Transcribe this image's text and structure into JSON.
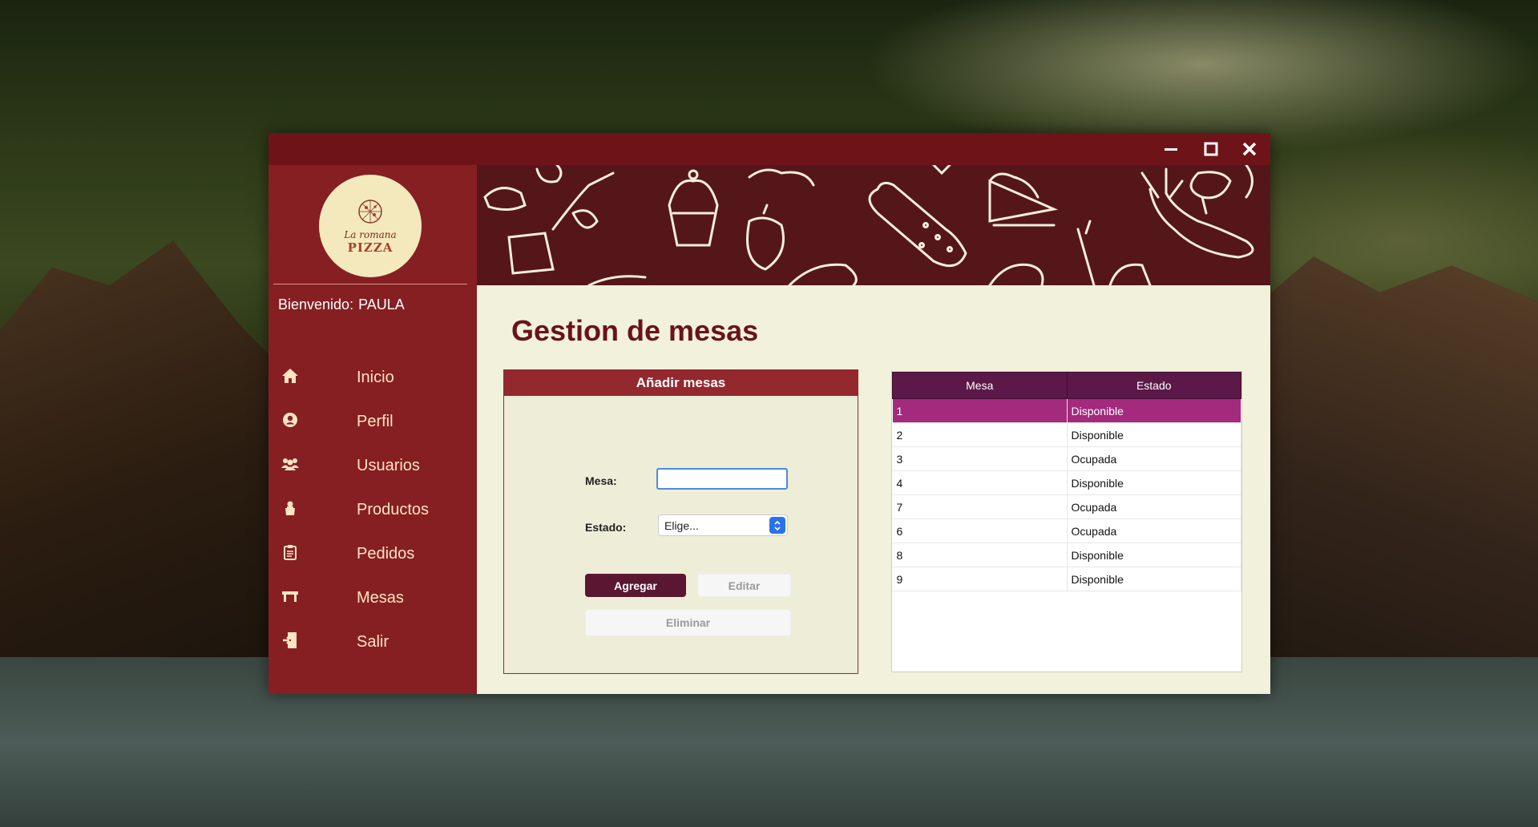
{
  "window": {
    "controls": {
      "minimize": "minimize-icon",
      "maximize": "maximize-icon",
      "close": "close-icon"
    }
  },
  "sidebar": {
    "logo": {
      "line1": "La romana",
      "line2": "PIZZA"
    },
    "welcome_label": "Bienvenido:",
    "user_name": "PAULA",
    "items": [
      {
        "label": "Inicio",
        "icon": "home-icon"
      },
      {
        "label": "Perfil",
        "icon": "user-icon"
      },
      {
        "label": "Usuarios",
        "icon": "users-icon"
      },
      {
        "label": "Productos",
        "icon": "chef-icon"
      },
      {
        "label": "Pedidos",
        "icon": "clipboard-icon"
      },
      {
        "label": "Mesas",
        "icon": "table-icon"
      },
      {
        "label": "Salir",
        "icon": "exit-icon"
      }
    ]
  },
  "main": {
    "title": "Gestion de mesas",
    "form": {
      "header": "Añadir mesas",
      "mesa_label": "Mesa:",
      "mesa_value": "",
      "estado_label": "Estado:",
      "estado_value": "Elige...",
      "agregar_label": "Agregar",
      "editar_label": "Editar",
      "eliminar_label": "Eliminar"
    },
    "table": {
      "columns": [
        "Mesa",
        "Estado"
      ],
      "rows": [
        {
          "mesa": "1",
          "estado": "Disponible",
          "selected": true
        },
        {
          "mesa": "2",
          "estado": "Disponible"
        },
        {
          "mesa": "3",
          "estado": "Ocupada"
        },
        {
          "mesa": "4",
          "estado": "Disponible"
        },
        {
          "mesa": "7",
          "estado": "Ocupada"
        },
        {
          "mesa": "6",
          "estado": "Ocupada"
        },
        {
          "mesa": "8",
          "estado": "Disponible"
        },
        {
          "mesa": "9",
          "estado": "Disponible"
        }
      ]
    }
  },
  "colors": {
    "titlebar": "#6e1419",
    "sidebar": "#861f22",
    "banner": "#55161a",
    "accent": "#5a1731",
    "table_header": "#5c1848",
    "selected_row": "#a32a7d"
  }
}
